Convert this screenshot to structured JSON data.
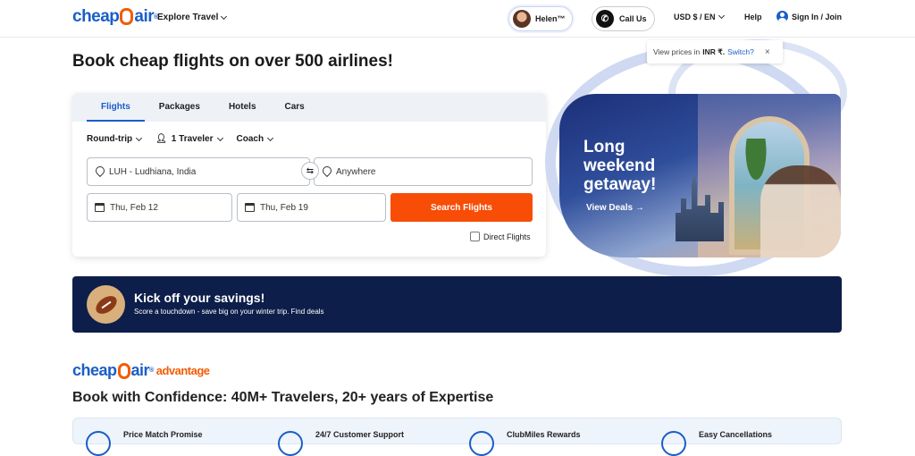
{
  "header": {
    "logo_pre": "cheap",
    "logo_post": "air",
    "explore": "Explore Travel",
    "agent_name": "Helen™",
    "call_us": "Call Us",
    "currency": "USD $ / EN",
    "help": "Help",
    "sign_in": "Sign In / Join"
  },
  "headline": "Book cheap flights on over 500 airlines!",
  "search": {
    "tabs": [
      "Flights",
      "Packages",
      "Hotels",
      "Cars"
    ],
    "trip_type": "Round-trip",
    "travelers": "1 Traveler",
    "cabin": "Coach",
    "from": "LUH - Ludhiana, India",
    "to": "Anywhere",
    "depart": "Thu, Feb 12",
    "return": "Thu, Feb 19",
    "button": "Search Flights",
    "direct": "Direct Flights"
  },
  "tooltip": {
    "text": "View prices in",
    "currency": "INR ₹.",
    "switch": "Switch?",
    "close": "×"
  },
  "promo": {
    "title": "Long weekend getaway!",
    "link": "View Deals →"
  },
  "banner": {
    "title": "Kick off your savings!",
    "subtitle": "Score a touchdown - save big on your winter trip. Find deals"
  },
  "advantage": {
    "logo_pre": "cheap",
    "logo_post": "air",
    "suffix": "advantage",
    "heading": "Book with Confidence: 40M+ Travelers, 20+ years of Expertise",
    "features": [
      "Price Match Promise",
      "24/7 Customer Support",
      "ClubMiles Rewards",
      "Easy Cancellations"
    ]
  }
}
